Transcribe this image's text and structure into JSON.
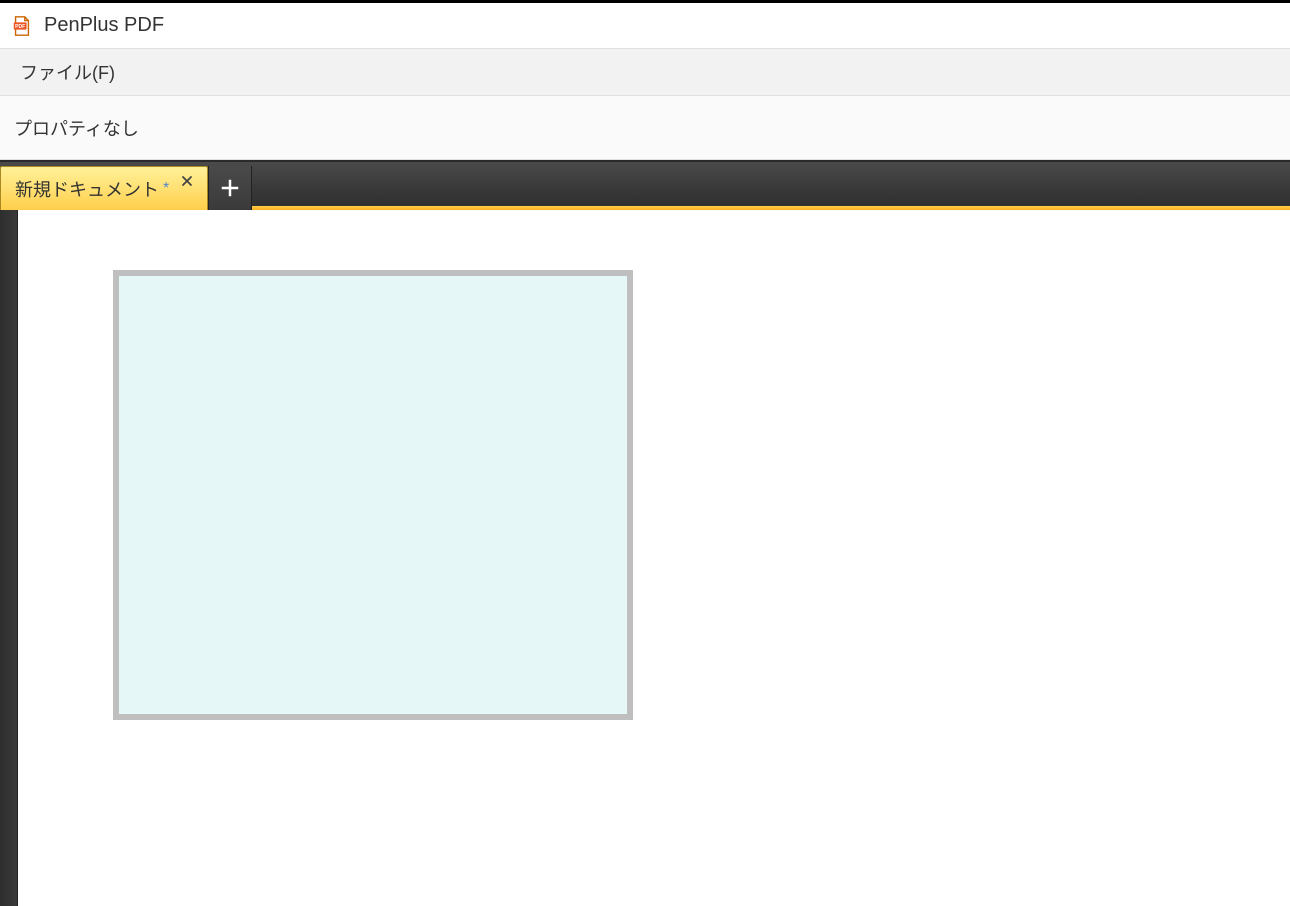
{
  "app": {
    "title": "PenPlus PDF"
  },
  "menubar": {
    "file": "ファイル(F)"
  },
  "toolbar": {
    "properties_empty": "プロパティなし"
  },
  "tabs": [
    {
      "label": "新規ドキュメント",
      "modified_marker": "*"
    }
  ]
}
